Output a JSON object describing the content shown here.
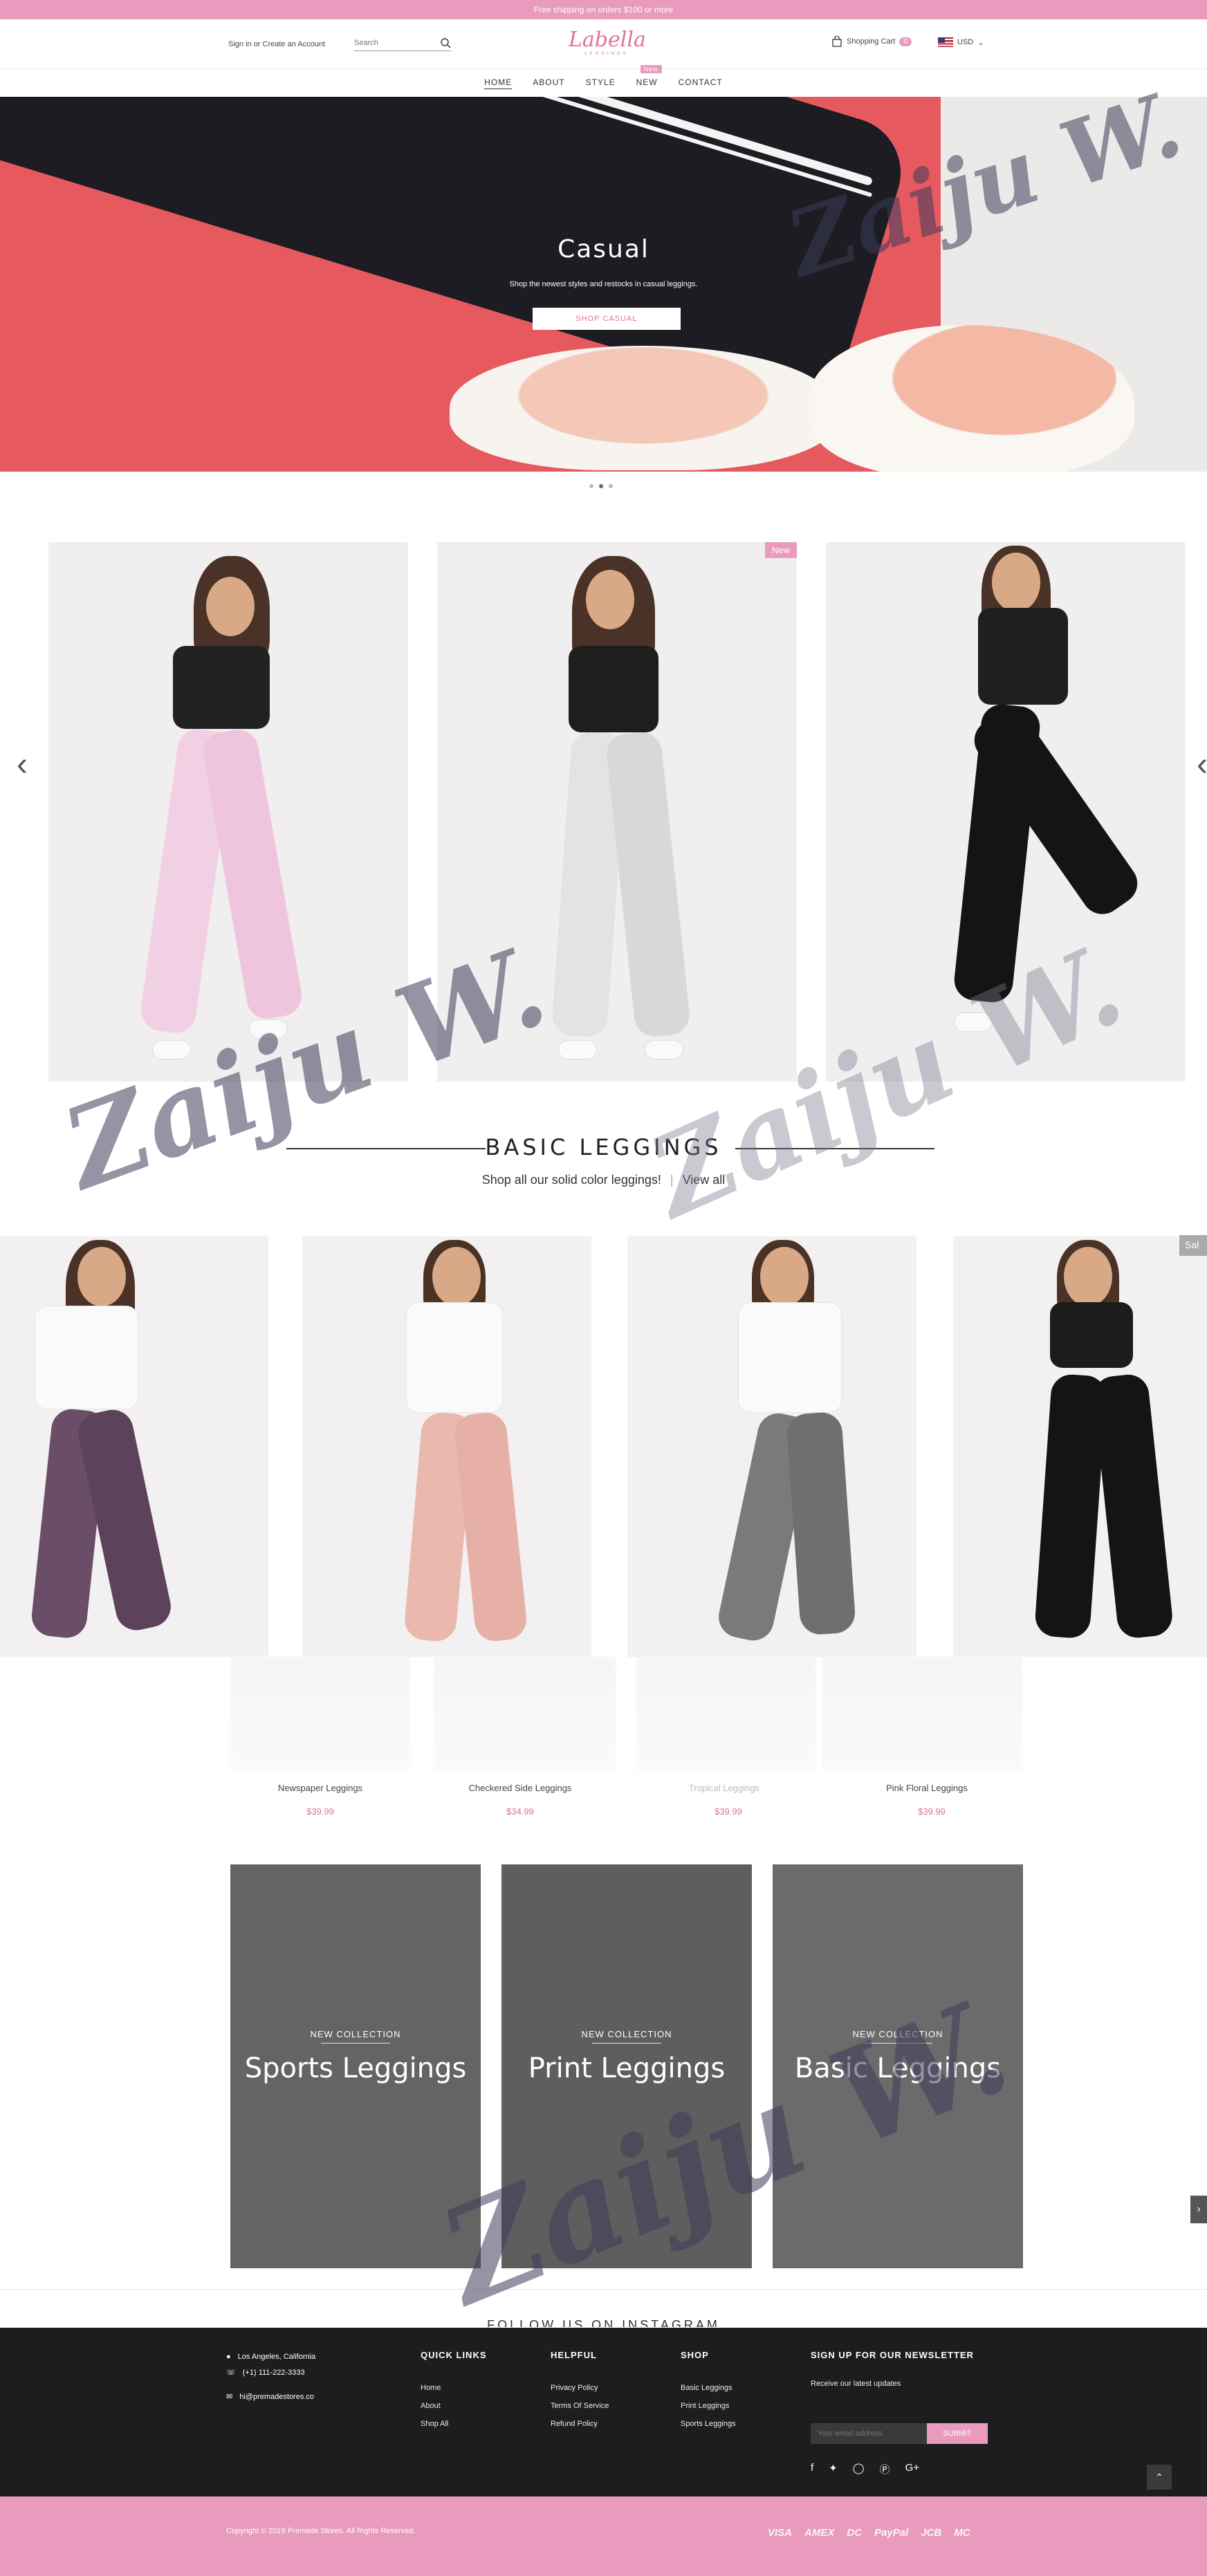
{
  "announcement": "Free shipping on orders $100 or more",
  "header": {
    "signin": "Sign in or Create an Account",
    "search_placeholder": "Search",
    "logo": "Labella",
    "logo_sub": "LEGGINGS",
    "cart_label": "Shopping Cart",
    "cart_count": "0",
    "currency": "USD"
  },
  "nav": {
    "items": [
      {
        "label": "HOME"
      },
      {
        "label": "ABOUT"
      },
      {
        "label": "STYLE"
      },
      {
        "label": "NEW",
        "badge": "New"
      },
      {
        "label": "CONTACT"
      }
    ]
  },
  "hero": {
    "title": "Casual",
    "subtitle": "Shop the newest styles and restocks in casual leggings.",
    "button": "SHOP CASUAL"
  },
  "featured": {
    "badge": "New"
  },
  "section": {
    "title": "BASIC LEGGINGS",
    "subtitle": "Shop all our solid color leggings!",
    "link": "View all"
  },
  "grid": {
    "sale_tag": "Sal"
  },
  "products": [
    {
      "name": "Newspaper Leggings",
      "price": "$39.99"
    },
    {
      "name": "Checkered Side Leggings",
      "price": "$34.99"
    },
    {
      "name": "Tropical Leggings",
      "price": "$39.99"
    },
    {
      "name": "Pink Floral Leggings",
      "price": "$39.99"
    }
  ],
  "collections": [
    {
      "eyebrow": "NEW COLLECTION",
      "title": "Sports Leggings"
    },
    {
      "eyebrow": "NEW COLLECTION",
      "title": "Print Leggings"
    },
    {
      "eyebrow": "NEW COLLECTION",
      "title": "Basic Leggings"
    }
  ],
  "instagram_title": "FOLLOW US ON INSTAGRAM",
  "footer": {
    "address": "Los Angeles, California",
    "phone": "(+1) 111-222-3333",
    "email": "hi@premadestores.co",
    "quick_links": {
      "title": "QUICK LINKS",
      "items": [
        "Home",
        "About",
        "Shop All"
      ]
    },
    "helpful": {
      "title": "HELPFUL",
      "items": [
        "Privacy Policy",
        "Terms Of Service",
        "Refund Policy"
      ]
    },
    "shop": {
      "title": "SHOP",
      "items": [
        "Basic Leggings",
        "Print Leggings",
        "Sports Leggings"
      ]
    },
    "newsletter": {
      "title": "SIGN UP FOR OUR NEWSLETTER",
      "text": "Receive our latest updates",
      "placeholder": "Your email address",
      "button": "SUBMIT"
    },
    "copyright": "Copyright © 2019 Premade Stores. All Rights Reserved.",
    "payments": [
      "VISA",
      "AMEX",
      "DC",
      "PayPal",
      "JCB",
      "MC"
    ]
  },
  "watermark": "Zaiju W.",
  "colors": {
    "accent": "#e89bbd",
    "accent_text": "#e0709f",
    "footer_bg": "#1d1d1d"
  }
}
